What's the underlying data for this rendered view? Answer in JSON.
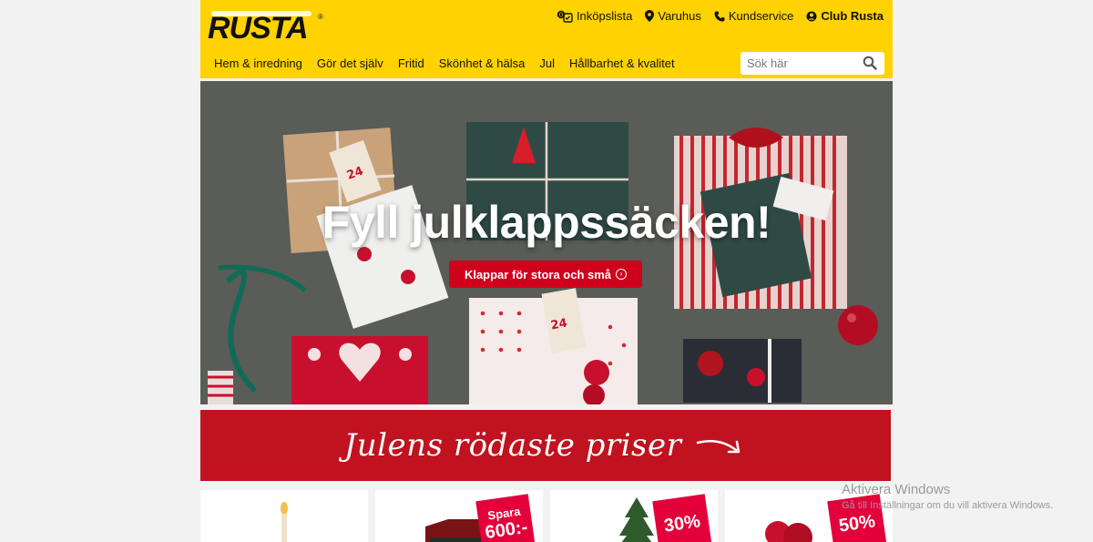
{
  "header": {
    "logo_text": "RUSTA",
    "logo_mark": "®",
    "top_links": [
      {
        "label": "Inköpslista",
        "icon": "shopping-list-icon"
      },
      {
        "label": "Varuhus",
        "icon": "map-pin-icon"
      },
      {
        "label": "Kundservice",
        "icon": "phone-icon"
      },
      {
        "label": "Club Rusta",
        "icon": "user-icon"
      }
    ],
    "nav": [
      "Hem & inredning",
      "Gör det själv",
      "Fritid",
      "Skönhet & hälsa",
      "Jul",
      "Hållbarhet & kvalitet"
    ],
    "search_placeholder": "Sök här"
  },
  "hero": {
    "title": "Fyll julklappssäcken!",
    "button_label": "Klappar för stora och små"
  },
  "promo": {
    "text": "Julens rödaste priser"
  },
  "cards": [
    {
      "badge": null
    },
    {
      "badge_small": "Spara",
      "badge_big": "600:-"
    },
    {
      "badge_small": "",
      "badge_big": "30%"
    },
    {
      "badge_small": "",
      "badge_big": "50%"
    }
  ],
  "watermark": {
    "title": "Aktivera Windows",
    "subtitle": "Gå till Inställningar om du vill aktivera Windows."
  },
  "colors": {
    "brand_yellow": "#ffd200",
    "brand_red": "#c1121f",
    "badge_red": "#e4003a"
  }
}
